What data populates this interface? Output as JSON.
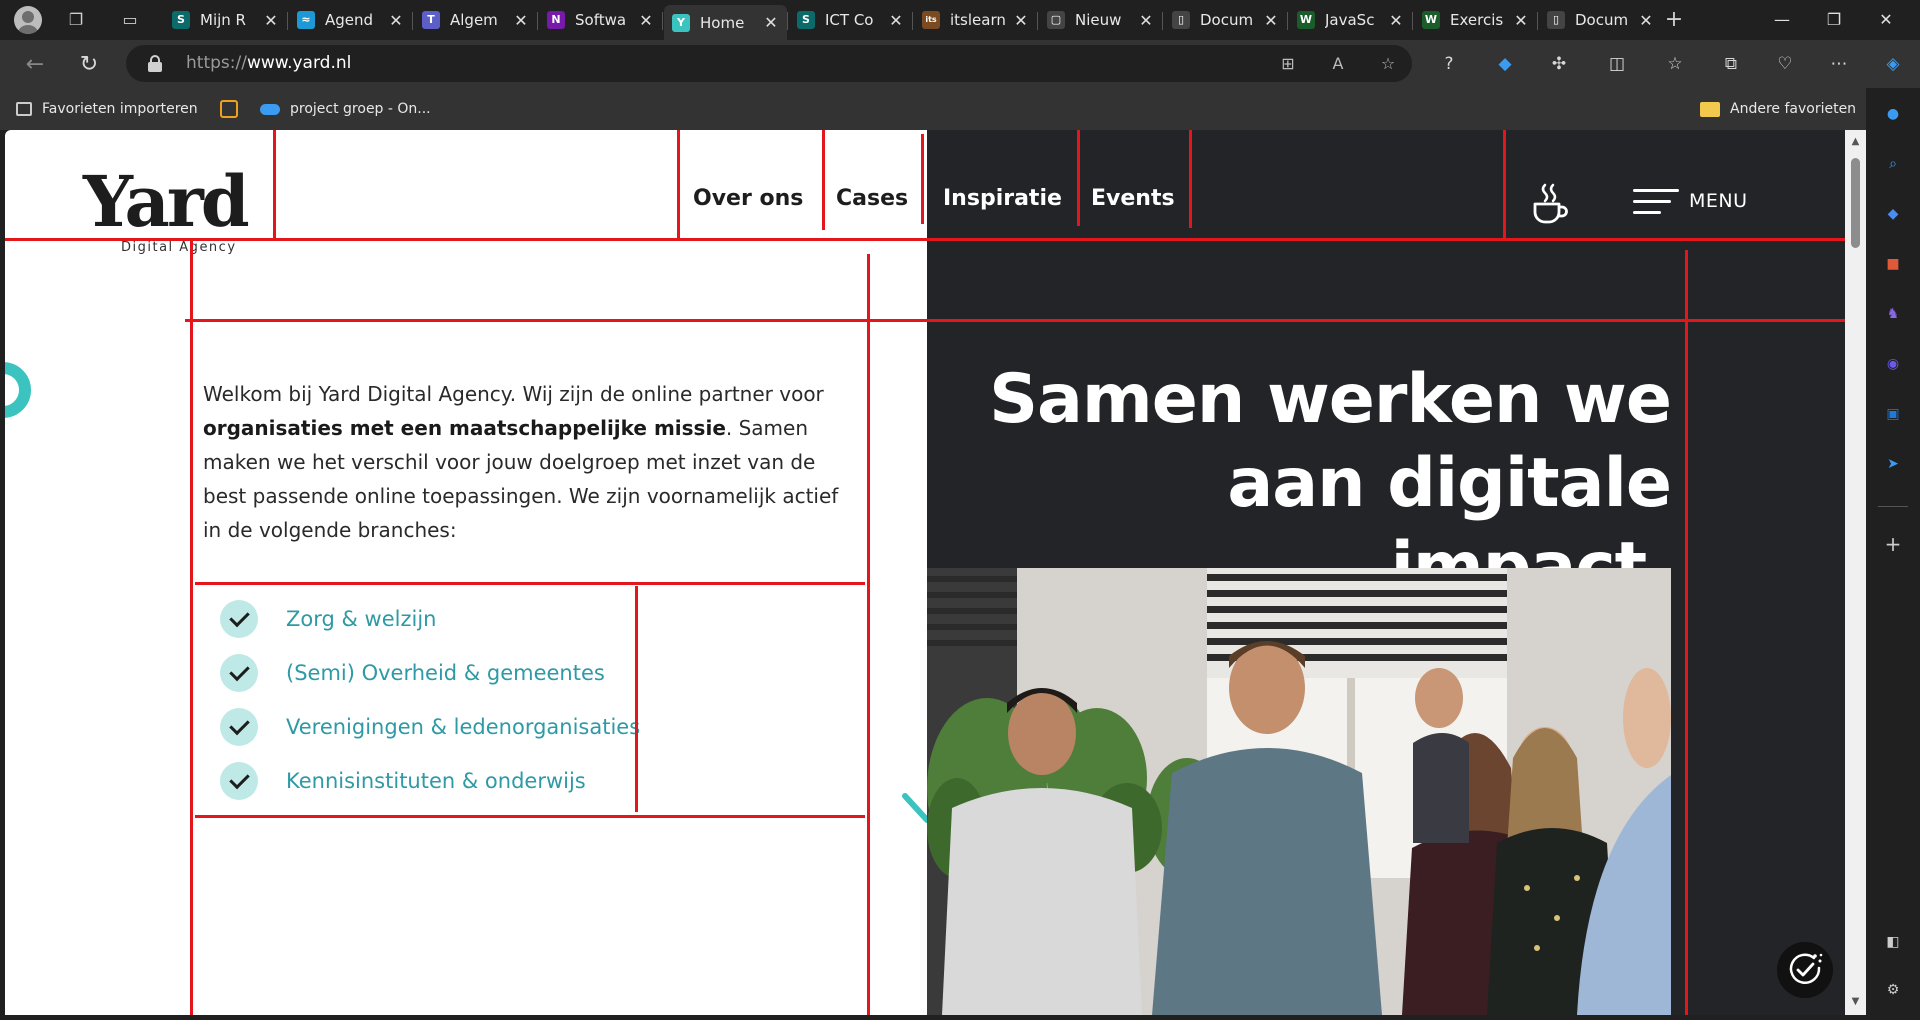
{
  "browser": {
    "tabs": [
      {
        "title": "Mijn R",
        "favicon_color": "#0b6a6a",
        "favicon_glyph": "S",
        "active": false
      },
      {
        "title": "Agend",
        "favicon_color": "#1d9ad6",
        "favicon_glyph": "≈",
        "active": false
      },
      {
        "title": "Algem",
        "favicon_color": "#5b5fc7",
        "favicon_glyph": "T",
        "active": false
      },
      {
        "title": "Softwa",
        "favicon_color": "#7719aa",
        "favicon_glyph": "N",
        "active": false
      },
      {
        "title": "Home",
        "favicon_color": "#3bc3c0",
        "favicon_glyph": "Y",
        "active": true
      },
      {
        "title": "ICT Co",
        "favicon_color": "#0b6a6a",
        "favicon_glyph": "S",
        "active": false
      },
      {
        "title": "itslearn",
        "favicon_color": "#7a4a20",
        "favicon_glyph": "its",
        "active": false
      },
      {
        "title": "Nieuw",
        "favicon_color": "#444444",
        "favicon_glyph": "▢",
        "active": false
      },
      {
        "title": "Docum",
        "favicon_color": "#444444",
        "favicon_glyph": "▯",
        "active": false
      },
      {
        "title": "JavaSc",
        "favicon_color": "#1a5d2a",
        "favicon_glyph": "W",
        "active": false
      },
      {
        "title": "Exercis",
        "favicon_color": "#1a5d2a",
        "favicon_glyph": "W",
        "active": false
      },
      {
        "title": "Docum",
        "favicon_color": "#444444",
        "favicon_glyph": "▯",
        "active": false
      }
    ],
    "address": {
      "protocol": "https://",
      "host": "www.yard.nl"
    },
    "favorites": [
      {
        "label": "Favorieten importeren"
      },
      {
        "label": ""
      },
      {
        "label": "project groep - On..."
      }
    ],
    "other_favorites": "Andere favorieten"
  },
  "site": {
    "logo_word": "Yard",
    "logo_sub": "Digital Agency",
    "nav": {
      "over_ons": "Over ons",
      "cases": "Cases",
      "inspiratie": "Inspiratie",
      "events": "Events"
    },
    "menu_label": "MENU",
    "intro": {
      "part1": "Welkom bij Yard Digital Agency. Wij zijn de online partner voor ",
      "bold": "organisaties met een maatschappelijke missie",
      "part2": ". Samen maken we het verschil voor jouw doelgroep met inzet van de best passende online toepassingen. We zijn voornamelijk actief in de volgende branches:"
    },
    "branches": [
      "Zorg & welzijn",
      "(Semi) Overheid & gemeentes",
      "Verenigingen & ledenorganisaties",
      "Kennisinstituten & onderwijs"
    ],
    "hero": {
      "line1": "Samen werken we",
      "line2": "aan digitale impact",
      "dot": "."
    },
    "colors": {
      "accent": "#3bc3c0",
      "dark": "#232427",
      "link": "#2d9aa6",
      "overlay_line": "#e3161b"
    }
  }
}
